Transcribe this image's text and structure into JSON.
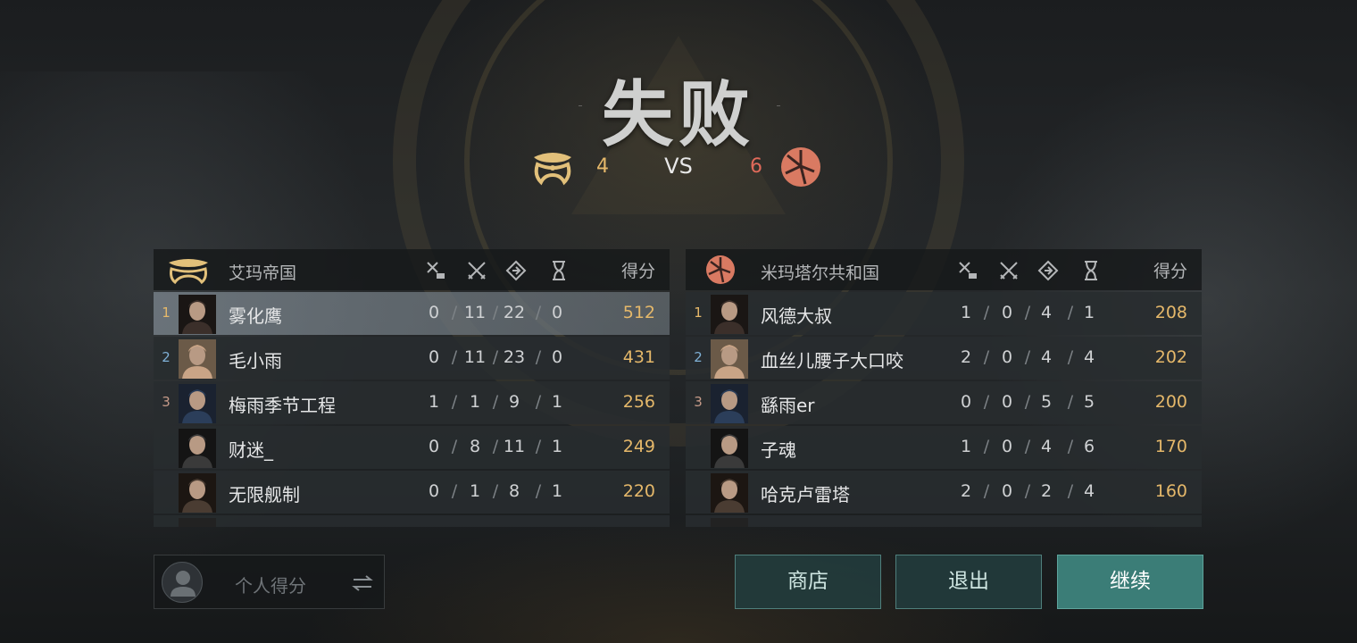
{
  "result": {
    "title": "失败",
    "vs_label": "VS",
    "left_score": "4",
    "right_score": "6"
  },
  "colors": {
    "gold": "#e5b86a",
    "red_team": "#e06a5a",
    "teal_button": "#3b7d77",
    "selected_row": "#7a838a"
  },
  "left_team": {
    "name": "艾玛帝国",
    "icon": "amarr-emblem-icon",
    "score_header": "得分",
    "stat_icons": [
      "kill-assist-icon",
      "crossed-swords-icon",
      "diamond-arrow-icon",
      "hourglass-icon"
    ],
    "players": [
      {
        "rank": "1",
        "name": "雾化鹰",
        "s1": "0",
        "s2": "11",
        "s3": "22",
        "s4": "0",
        "score": "512"
      },
      {
        "rank": "2",
        "name": "毛小雨",
        "s1": "0",
        "s2": "11",
        "s3": "23",
        "s4": "0",
        "score": "431"
      },
      {
        "rank": "3",
        "name": "梅雨季节工程",
        "s1": "1",
        "s2": "1",
        "s3": "9",
        "s4": "1",
        "score": "256"
      },
      {
        "rank": "",
        "name": "财迷_",
        "s1": "0",
        "s2": "8",
        "s3": "11",
        "s4": "1",
        "score": "249"
      },
      {
        "rank": "",
        "name": "无限舰制",
        "s1": "0",
        "s2": "1",
        "s3": "8",
        "s4": "1",
        "score": "220"
      }
    ]
  },
  "right_team": {
    "name": "米玛塔尔共和国",
    "icon": "minmatar-emblem-icon",
    "score_header": "得分",
    "stat_icons": [
      "kill-assist-icon",
      "crossed-swords-icon",
      "diamond-arrow-icon",
      "hourglass-icon"
    ],
    "players": [
      {
        "rank": "1",
        "name": "风德大叔",
        "s1": "1",
        "s2": "0",
        "s3": "4",
        "s4": "1",
        "score": "208"
      },
      {
        "rank": "2",
        "name": "血丝儿腰子大口咬",
        "s1": "2",
        "s2": "0",
        "s3": "4",
        "s4": "4",
        "score": "202"
      },
      {
        "rank": "3",
        "name": "繇雨er",
        "s1": "0",
        "s2": "0",
        "s3": "5",
        "s4": "5",
        "score": "200"
      },
      {
        "rank": "",
        "name": "子魂",
        "s1": "1",
        "s2": "0",
        "s3": "4",
        "s4": "6",
        "score": "170"
      },
      {
        "rank": "",
        "name": "哈克卢雷塔",
        "s1": "2",
        "s2": "0",
        "s3": "2",
        "s4": "4",
        "score": "160"
      }
    ]
  },
  "personal": {
    "label": "个人得分",
    "icon": "swap-arrows-icon"
  },
  "buttons": {
    "shop": "商店",
    "quit": "退出",
    "continue": "继续"
  }
}
